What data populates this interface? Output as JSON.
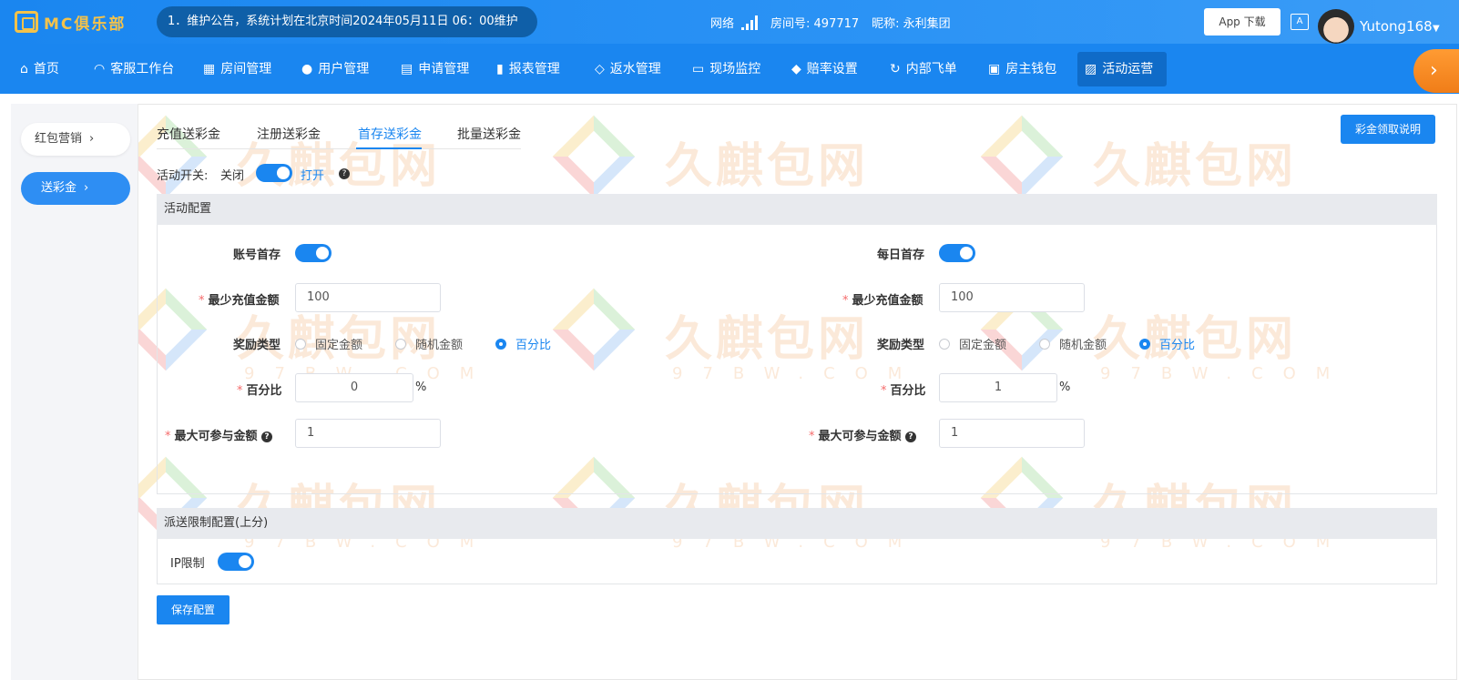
{
  "header": {
    "logo_text": "MC俱乐部",
    "notice": "1．维护公告，系统计划在北京时间2024年05月11日 06：00维护",
    "network_label": "网络",
    "room_label": "房间号: 497717",
    "nickname_label": "昵称: 永利集团",
    "app_download": "App 下载",
    "translate_icon_text": "A",
    "username": "Yutong168"
  },
  "nav": {
    "items": [
      {
        "label": "首页",
        "icon": "home-icon"
      },
      {
        "label": "客服工作台",
        "icon": "headset-icon"
      },
      {
        "label": "房间管理",
        "icon": "grid-icon"
      },
      {
        "label": "用户管理",
        "icon": "user-icon"
      },
      {
        "label": "申请管理",
        "icon": "document-icon"
      },
      {
        "label": "报表管理",
        "icon": "bar-chart-icon"
      },
      {
        "label": "返水管理",
        "icon": "tag-icon"
      },
      {
        "label": "现场监控",
        "icon": "monitor-icon"
      },
      {
        "label": "赔率设置",
        "icon": "shield-icon"
      },
      {
        "label": "内部飞单",
        "icon": "refresh-icon"
      },
      {
        "label": "房主钱包",
        "icon": "wallet-icon"
      },
      {
        "label": "活动运营",
        "icon": "activity-icon"
      }
    ],
    "active_index": 11
  },
  "sidebar": {
    "items": [
      {
        "label": "红包营销",
        "active": false
      },
      {
        "label": "送彩金",
        "active": true
      }
    ]
  },
  "tabs": {
    "items": [
      "充值送彩金",
      "注册送彩金",
      "首存送彩金",
      "批量送彩金"
    ],
    "active_index": 2,
    "explain_button": "彩金领取说明"
  },
  "activity_switch": {
    "label": "活动开关:",
    "off_text": "关闭",
    "on_text": "打开",
    "enabled": true
  },
  "config": {
    "section_title": "活动配置",
    "left": {
      "toggle_label": "账号首存",
      "toggle_on": true,
      "min_amount_label": "最少充值金额",
      "min_amount_value": "100",
      "reward_type_label": "奖励类型",
      "reward_options": [
        "固定金额",
        "随机金额",
        "百分比"
      ],
      "reward_selected": 2,
      "percent_label": "百分比",
      "percent_value": "0",
      "percent_unit": "%",
      "max_amount_label": "最大可参与金额",
      "max_amount_value": "1"
    },
    "right": {
      "toggle_label": "每日首存",
      "toggle_on": true,
      "min_amount_label": "最少充值金额",
      "min_amount_value": "100",
      "reward_type_label": "奖励类型",
      "reward_options": [
        "固定金额",
        "随机金额",
        "百分比"
      ],
      "reward_selected": 2,
      "percent_label": "百分比",
      "percent_value": "1",
      "percent_unit": "%",
      "max_amount_label": "最大可参与金额",
      "max_amount_value": "1"
    }
  },
  "limits": {
    "section_title": "派送限制配置(上分)",
    "ip_label": "IP限制",
    "ip_on": true
  },
  "save_button": "保存配置",
  "watermark": {
    "text": "久麒包网",
    "sub": "97BW.COM"
  },
  "colors": {
    "primary": "#1a86f0",
    "required": "#f56c6c",
    "accent_orange": "#f07d18"
  }
}
